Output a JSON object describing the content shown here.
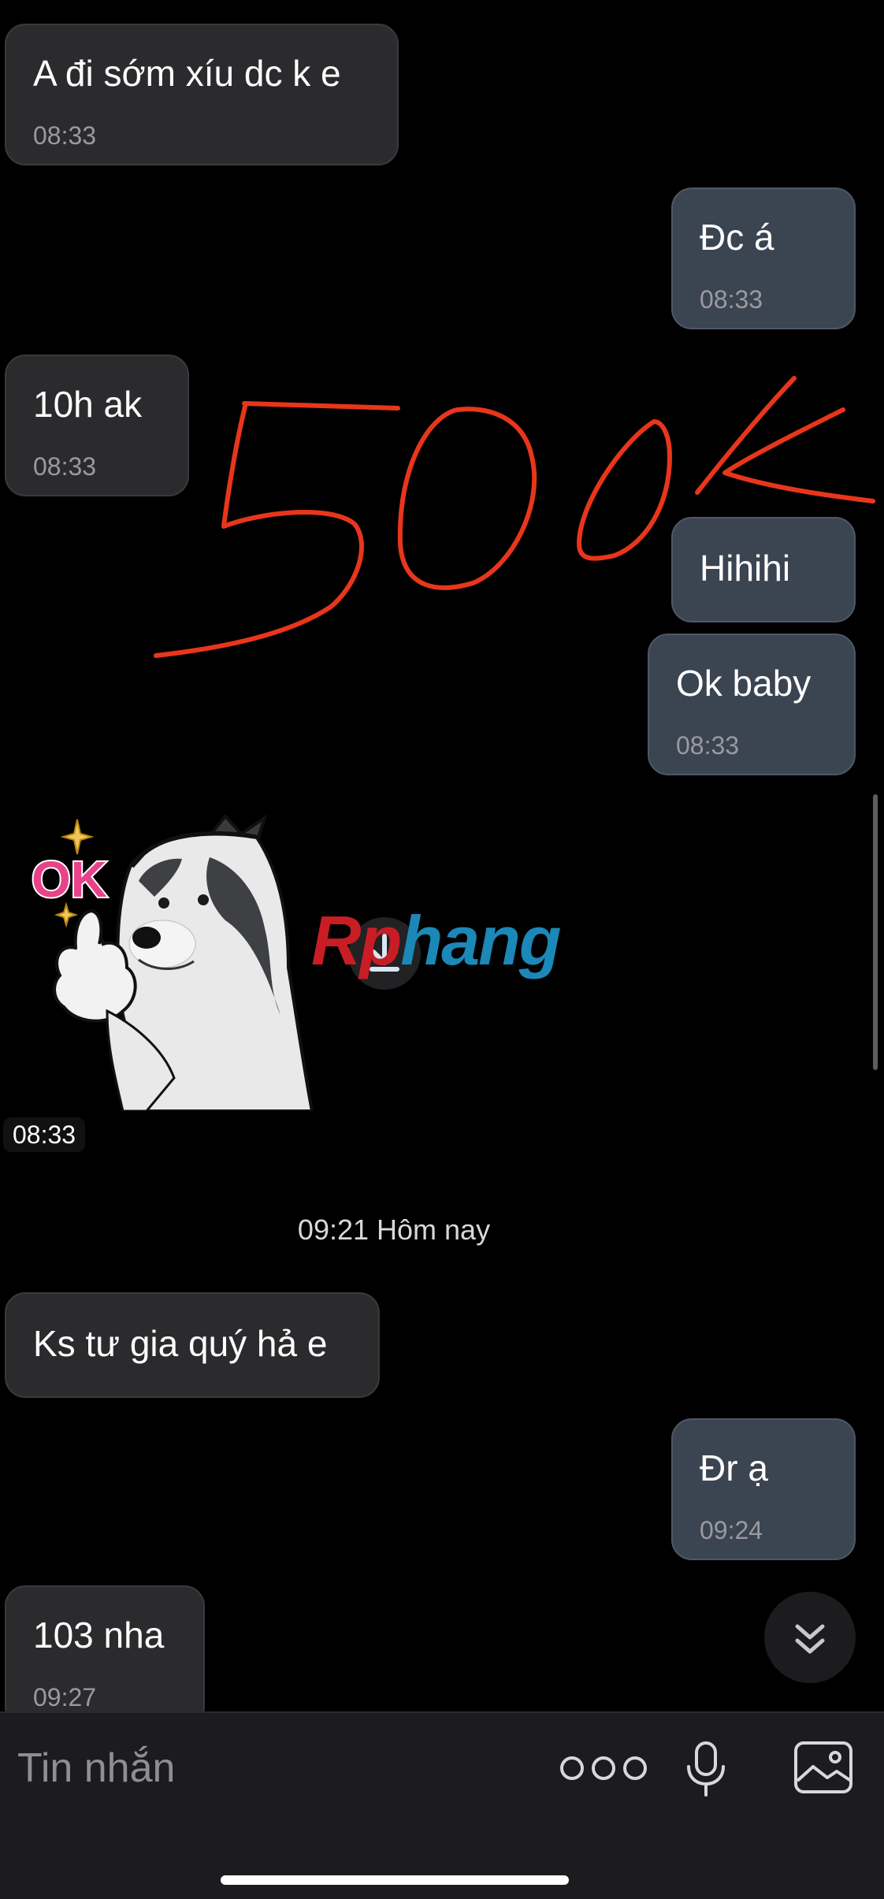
{
  "messages": [
    {
      "dir": "in",
      "text": "A đi sớm xíu dc k e",
      "time": "08:33"
    },
    {
      "dir": "out",
      "text": "Đc á",
      "time": "08:33"
    },
    {
      "dir": "in",
      "text": "10h ak",
      "time": "08:33"
    },
    {
      "dir": "out",
      "text": "Hihihi",
      "time": ""
    },
    {
      "dir": "out",
      "text": "Ok baby",
      "time": "08:33"
    }
  ],
  "sticker": {
    "caption": "OK",
    "time": "08:33"
  },
  "drawing": {
    "text": "500K",
    "color": "#e8361b"
  },
  "watermark": {
    "part1": "Rp",
    "part2": "hang"
  },
  "date_separator": "09:21 Hôm nay",
  "messages_today": [
    {
      "dir": "in",
      "text": "Ks tư gia quý hả e",
      "time": ""
    },
    {
      "dir": "out",
      "text": "Đr ạ",
      "time": "09:24"
    },
    {
      "dir": "in",
      "text": "103 nha",
      "time": "09:27"
    }
  ],
  "composer": {
    "placeholder": "Tin nhắn"
  },
  "icons": {
    "more": "more-dots-icon",
    "mic": "microphone-icon",
    "image": "image-icon",
    "scroll": "chevron-double-down-icon",
    "download": "download-icon"
  }
}
